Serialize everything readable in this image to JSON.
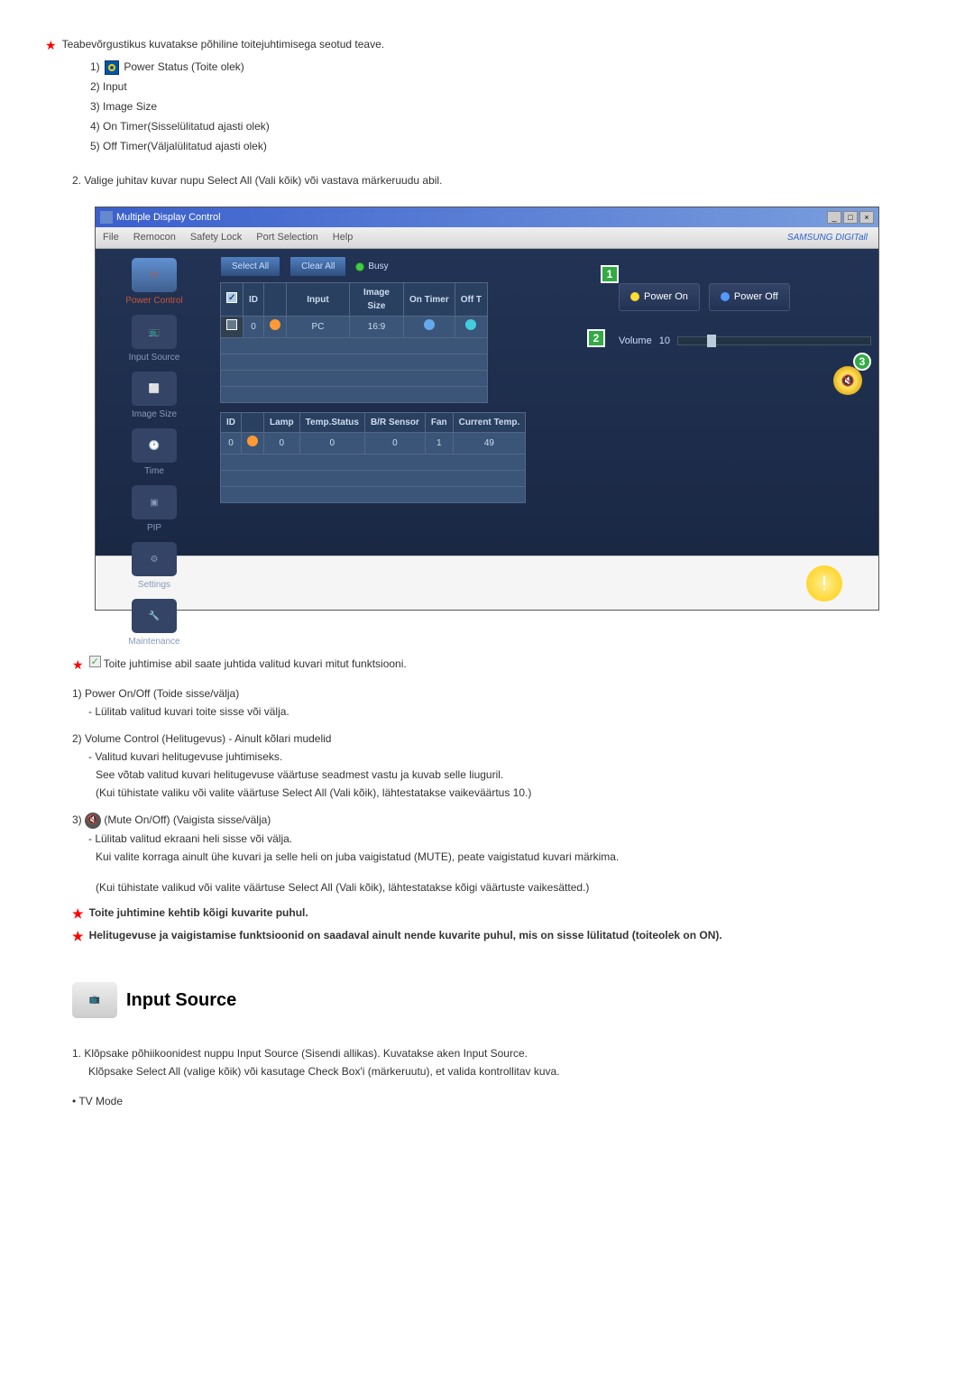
{
  "intro": {
    "star_text": "Teabevõrgustikus kuvatakse põhiline toitejuhtimisega seotud teave.",
    "items": [
      "1)",
      "Power Status (Toite olek)",
      "2) Input",
      "3) Image Size",
      "4) On Timer(Sisselülitatud ajasti olek)",
      "5) Off Timer(Väljalülitatud ajasti olek)"
    ]
  },
  "step2": "2.  Valige juhitav kuvar nupu Select All (Vali kõik) või vastava märkeruudu abil.",
  "app": {
    "title": "Multiple Display Control",
    "menu": [
      "File",
      "Remocon",
      "Safety Lock",
      "Port Selection",
      "Help"
    ],
    "brand": "SAMSUNG DIGITall",
    "sidebar": [
      {
        "label": "Power Control",
        "active": true
      },
      {
        "label": "Input Source"
      },
      {
        "label": "Image Size"
      },
      {
        "label": "Time"
      },
      {
        "label": "PIP"
      },
      {
        "label": "Settings"
      },
      {
        "label": "Maintenance"
      }
    ],
    "toolbar": {
      "select_all": "Select All",
      "clear_all": "Clear All",
      "busy": "Busy"
    },
    "table1": {
      "headers": [
        "",
        "ID",
        "",
        "Input",
        "Image Size",
        "On Timer",
        "Off T"
      ],
      "row": [
        "",
        "0",
        "",
        "PC",
        "16:9",
        "",
        ""
      ]
    },
    "table2": {
      "headers": [
        "ID",
        "",
        "Lamp",
        "Temp.Status",
        "B/R Sensor",
        "Fan",
        "Current Temp."
      ],
      "row": [
        "0",
        "",
        "0",
        "0",
        "0",
        "1",
        "49"
      ]
    },
    "power_on": "Power On",
    "power_off": "Power Off",
    "volume_label": "Volume",
    "volume_value": "10"
  },
  "control_text": "Toite juhtimise abil saate juhtida valitud kuvari mitut funktsiooni.",
  "items": [
    {
      "num": "1)",
      "title": "Power On/Off (Toide sisse/välja)",
      "sub": [
        "- Lülitab valitud kuvari toite sisse või välja."
      ]
    },
    {
      "num": "2)",
      "title": "Volume Control (Helitugevus) - Ainult kõlari mudelid",
      "sub": [
        "- Valitud kuvari helitugevuse juhtimiseks.",
        "See võtab valitud kuvari helitugevuse väärtuse seadmest vastu ja kuvab selle liuguril.",
        "(Kui tühistate valiku või valite väärtuse Select All (Vali kõik), lähtestatakse vaikeväärtus 10.)"
      ]
    },
    {
      "num": "3)",
      "title": "(Mute On/Off) (Vaigista sisse/välja)",
      "has_icon": true,
      "sub": [
        "- Lülitab valitud ekraani heli sisse või välja.",
        "Kui valite korraga ainult ühe kuvari ja selle heli on juba vaigistatud (MUTE), peate vaigistatud kuvari märkima.",
        "",
        "(Kui tühistate valikud või valite väärtuse Select All (Vali kõik), lähtestatakse kõigi väärtuste vaikesätted.)"
      ]
    }
  ],
  "notes": [
    "Toite juhtimine kehtib kõigi kuvarite puhul.",
    "Helitugevuse ja vaigistamise funktsioonid on saadaval ainult nende kuvarite puhul, mis on sisse lülitatud (toiteolek on ON)."
  ],
  "section2": {
    "title": "Input Source"
  },
  "final": [
    "1.  Klõpsake põhiikoonidest nuppu Input Source (Sisendi allikas). Kuvatakse aken Input Source.",
    "Klõpsake Select All (valige kõik) või kasutage Check Box'i (märkeruutu), et valida kontrollitav kuva.",
    "• TV Mode"
  ]
}
